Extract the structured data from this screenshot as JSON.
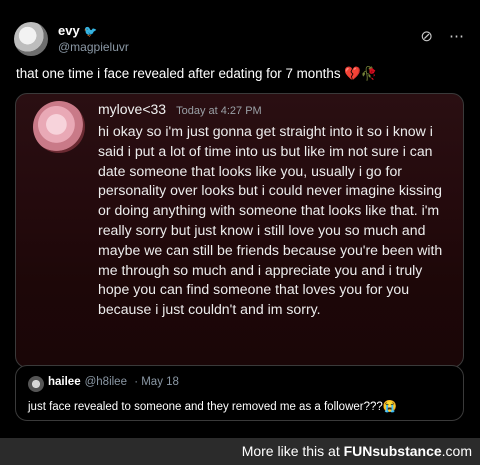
{
  "header": {
    "display_name": "evy",
    "name_icon": "bird-icon",
    "handle": "@magpieluvr",
    "icons": [
      "grok-icon",
      "more-options-icon"
    ]
  },
  "tweet": {
    "text": "that one time i face revealed after edating for 7 months 💔🥀"
  },
  "dm": {
    "name": "mylove<33",
    "time": "Today at 4:27 PM",
    "body": "hi okay so i'm just gonna get straight into it so i know i said i put a lot of time into us but like im not sure i can date someone that looks like you, usually i go for personality over looks but i could never imagine kissing or doing anything with someone that looks like that. i'm really sorry but just know i still love you so much and maybe we can still be friends because you're been with me through so much and i appreciate you and i truly hope you can find someone that loves you for you because i just couldn't and im sorry."
  },
  "quote": {
    "name": "hailee",
    "handle": "@h8ilee",
    "date": "· May 18",
    "text": "just face revealed to someone and they removed me as a follower???😭"
  },
  "footer": {
    "prefix": "More like this at ",
    "brand": "FUNsubstance",
    "suffix": ".com"
  }
}
